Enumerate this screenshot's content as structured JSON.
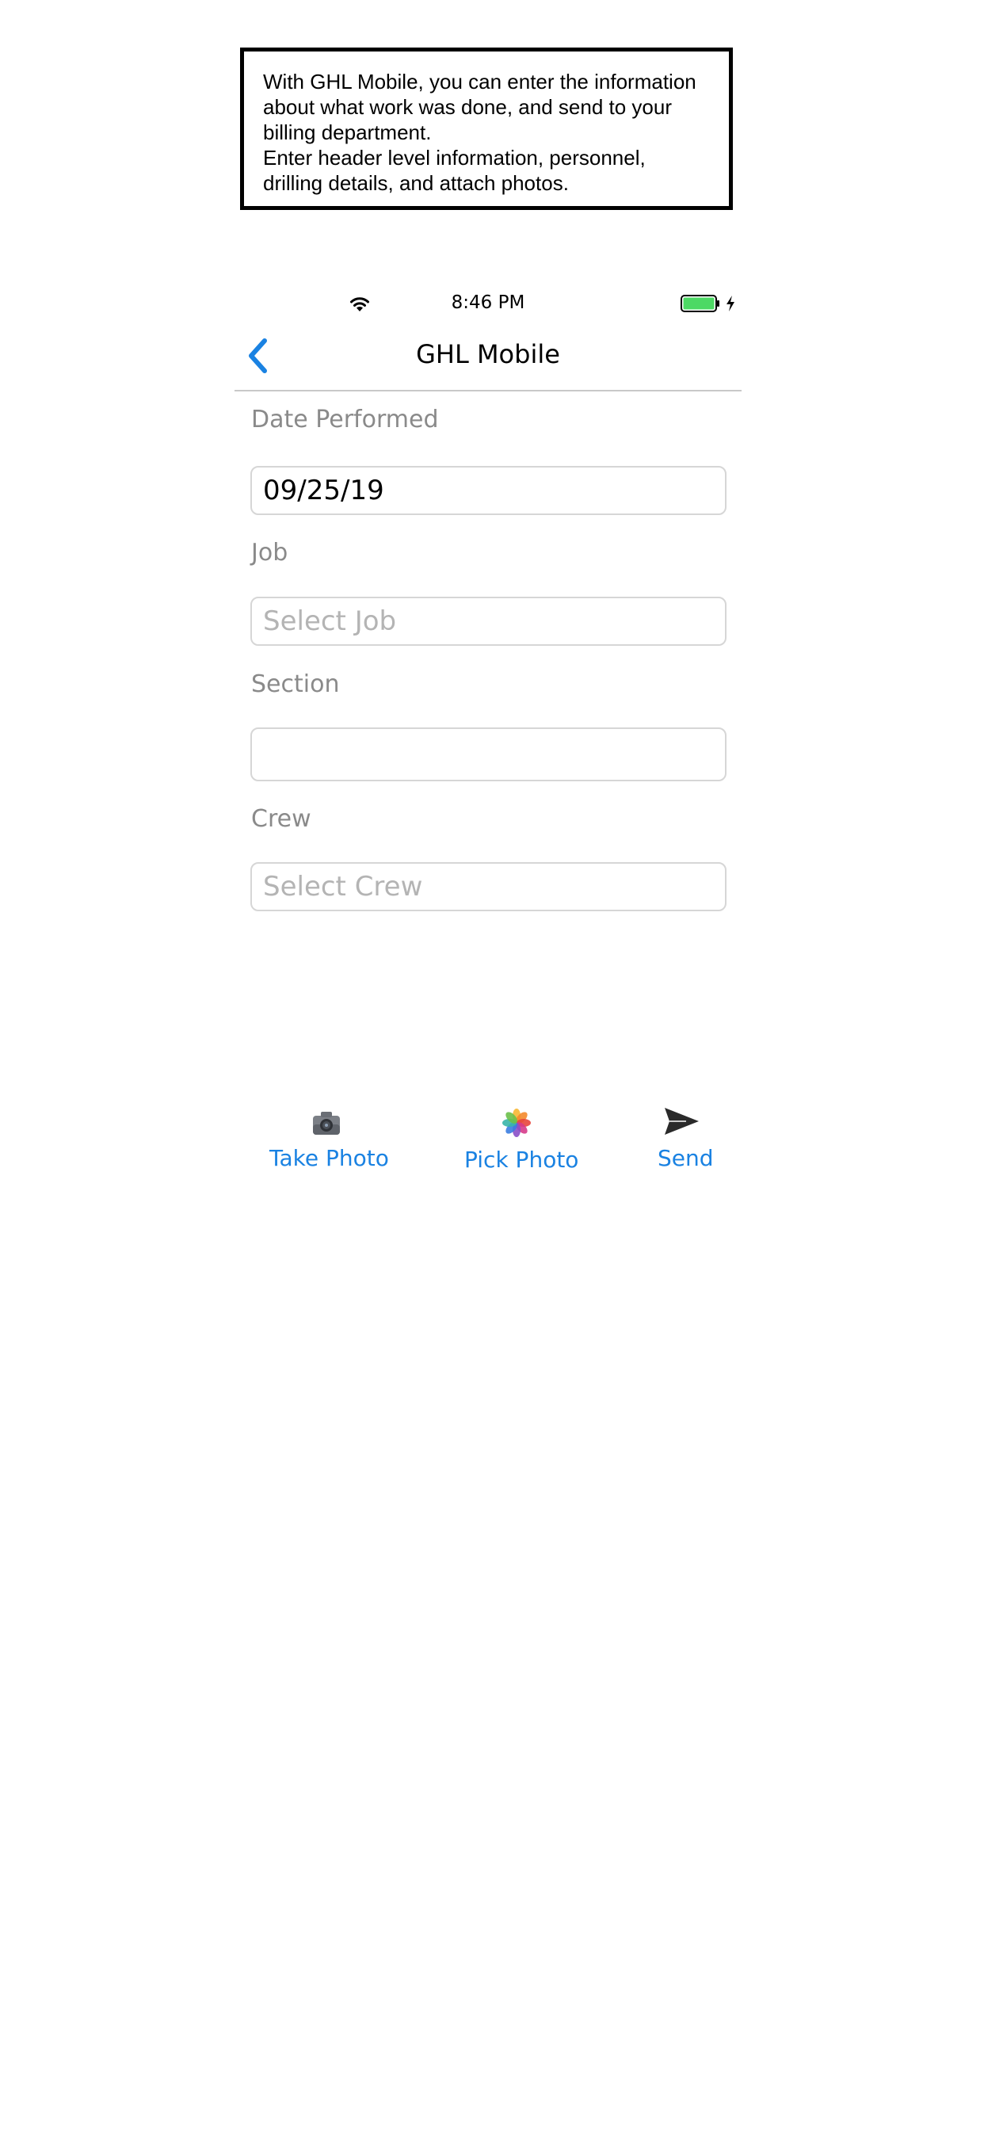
{
  "caption": {
    "line1": "With GHL Mobile, you can enter the information",
    "line2": "about what work was done, and send to your",
    "line3": "billing department.",
    "line4": "Enter header level information, personnel,",
    "line5": "drilling details, and attach photos."
  },
  "status_bar": {
    "time": "8:46 PM",
    "battery_color": "#4cd964"
  },
  "nav": {
    "title": "GHL Mobile",
    "back_icon": "chevron-left-icon",
    "accent_color": "#1a82e2"
  },
  "form": {
    "date_label": "Date Performed",
    "date_value": "09/25/19",
    "job_label": "Job",
    "job_placeholder": "Select Job",
    "section_label": "Section",
    "section_value": "",
    "crew_label": "Crew",
    "crew_placeholder": "Select Crew"
  },
  "toolbar": {
    "take_photo_label": "Take Photo",
    "take_photo_icon": "camera-icon",
    "pick_photo_label": "Pick Photo",
    "pick_photo_icon": "photos-icon",
    "send_label": "Send",
    "send_icon": "send-icon"
  }
}
